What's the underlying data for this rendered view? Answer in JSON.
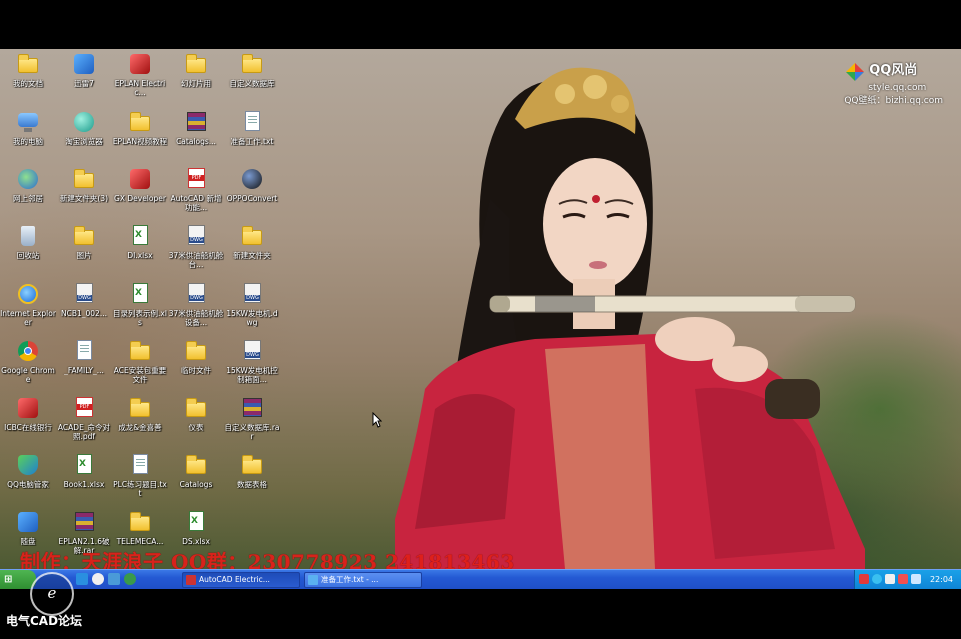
{
  "desktop_icons": [
    {
      "label": "我的文档",
      "type": "folder-docs"
    },
    {
      "label": "迅雷7",
      "type": "app-blue"
    },
    {
      "label": "EPLAN Electric...",
      "type": "app-red"
    },
    {
      "label": "幻灯片用",
      "type": "folder"
    },
    {
      "label": "自定义数据库",
      "type": "folder"
    },
    {
      "label": "我的电脑",
      "type": "computer"
    },
    {
      "label": "淘宝浏览器",
      "type": "circle-teal"
    },
    {
      "label": "EPLAN视频教程",
      "type": "folder"
    },
    {
      "label": "Catalogs...",
      "type": "rar"
    },
    {
      "label": "准备工作.txt",
      "type": "doc"
    },
    {
      "label": "网上邻居",
      "type": "network"
    },
    {
      "label": "新建文件夹(3)",
      "type": "folder"
    },
    {
      "label": "GX Developer",
      "type": "app-red"
    },
    {
      "label": "AutoCAD 新增功能...",
      "type": "pdf"
    },
    {
      "label": "OPPOConvert",
      "type": "circle-dark"
    },
    {
      "label": "回收站",
      "type": "recycle"
    },
    {
      "label": "图片",
      "type": "folder"
    },
    {
      "label": "DI.xlsx",
      "type": "xls"
    },
    {
      "label": "37米供油船机舱台...",
      "type": "dwg"
    },
    {
      "label": "新建文件夹",
      "type": "folder"
    },
    {
      "label": "Internet Explorer",
      "type": "ie"
    },
    {
      "label": "NCB1_002...",
      "type": "dwg"
    },
    {
      "label": "目录列表示例.xls",
      "type": "xls"
    },
    {
      "label": "37米供油船机舱设备...",
      "type": "dwg"
    },
    {
      "label": "15KW发电机.dwg",
      "type": "dwg"
    },
    {
      "label": "Google Chrome",
      "type": "chrome"
    },
    {
      "label": "_FAMILY_...",
      "type": "doc"
    },
    {
      "label": "ACE安装包重要文件",
      "type": "folder"
    },
    {
      "label": "临时文件",
      "type": "folder"
    },
    {
      "label": "15KW发电机控制箱面...",
      "type": "dwg"
    },
    {
      "label": "ICBC在线银行",
      "type": "app-red"
    },
    {
      "label": "ACADE_命令对照.pdf",
      "type": "pdf"
    },
    {
      "label": "成龙&金喜善",
      "type": "folder"
    },
    {
      "label": "仪表",
      "type": "folder"
    },
    {
      "label": "自定义数据库.rar",
      "type": "rar"
    },
    {
      "label": "QQ电脑管家",
      "type": "shield"
    },
    {
      "label": "Book1.xlsx",
      "type": "xls"
    },
    {
      "label": "PLC练习题目.txt",
      "type": "doc"
    },
    {
      "label": "Catalogs",
      "type": "folder"
    },
    {
      "label": "数据表格",
      "type": "folder"
    },
    {
      "label": "随盘",
      "type": "app-blue"
    },
    {
      "label": "EPLAN2.1.6破解.rar",
      "type": "rar"
    },
    {
      "label": "TELEMECA...",
      "type": "folder"
    },
    {
      "label": "DS.xlsx",
      "type": "xls"
    }
  ],
  "qq_logo": {
    "title": "QQ风尚",
    "site": "style.qq.com",
    "sub": "QQ壁纸：bizhi.qq.com"
  },
  "watermark": {
    "text": "制作：天涯浪子  QQ群：230778923     241813463"
  },
  "taskbar": {
    "start_label": "开始",
    "tasks": [
      {
        "label": "AutoCAD Electric...",
        "active": true
      },
      {
        "label": "准备工作.txt - ...",
        "active": false
      }
    ],
    "clock": "22:04"
  },
  "bottom_logo": {
    "text": "电气CAD论坛",
    "mark": "e"
  },
  "colors": {
    "taskbar": "#2459d3",
    "tray": "#0f84d6",
    "start": "#2f8f31",
    "watermark": "#e0201a"
  }
}
